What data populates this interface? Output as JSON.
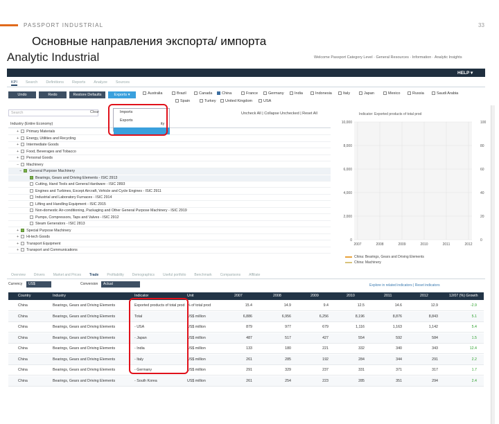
{
  "slide": {
    "company": "PASSPORT INDUSTRIAL",
    "page_number": "33",
    "title": "Основные направления экспорта/ импорта"
  },
  "app": {
    "brand": "Analytic Industrial",
    "welcome": "Welcome Passport Category Level  ·  General Resources  ·  Information  ·  Analytic Insights",
    "help": "HELP ▾",
    "tabs": [
      "KPI",
      "Search",
      "Definitions",
      "Reports",
      "Analyze",
      "Sources"
    ],
    "buttons": {
      "undo": "Undo",
      "redo": "Redo",
      "restore": "Restore Defaults",
      "exports": "Exports ▾"
    },
    "countries_row1": [
      "Australia",
      "Brazil",
      "Canada",
      "China",
      "France",
      "Germany",
      "India",
      "Indonesia",
      "Italy",
      "Japan",
      "Mexico",
      "Russia",
      "Saudi Arabia"
    ],
    "countries_row2": [
      "Spain",
      "Turkey",
      "United Kingdom",
      "USA"
    ],
    "search_placeholder": "Search",
    "clear": "Clear",
    "dropdown": {
      "imports": "Imports",
      "exports": "Exports",
      "tail": "ity"
    },
    "links": "Uncheck All  |  Collapse Unchecked  |  Reset All",
    "tree_header": "Industry (Entire Economy)",
    "tree": [
      {
        "pm": "+",
        "checked": false,
        "label": "Primary Materials",
        "hl": false
      },
      {
        "pm": "+",
        "checked": false,
        "label": "Energy, Utilities and Recycling",
        "hl": false
      },
      {
        "pm": "+",
        "checked": false,
        "label": "Intermediate Goods",
        "hl": false
      },
      {
        "pm": "+",
        "checked": false,
        "label": "Food, Beverages and Tobacco",
        "hl": false
      },
      {
        "pm": "+",
        "checked": false,
        "label": "Personal Goods",
        "hl": false
      },
      {
        "pm": "−",
        "checked": false,
        "label": "Machinery",
        "hl": false
      },
      {
        "pm": "−",
        "checked": true,
        "label": "General Purpose Machinery",
        "hl": true
      },
      {
        "pm": "",
        "checked": true,
        "label": "Bearings, Gears and Driving Elements - ISIC 2913",
        "hl": true
      },
      {
        "pm": "",
        "checked": false,
        "label": "Cutting, Hand Tools and General Hardware - ISIC 2893",
        "hl": false
      },
      {
        "pm": "",
        "checked": false,
        "label": "Engines and Turbines, Except Aircraft, Vehicle and Cycle Engines - ISIC 2911",
        "hl": false
      },
      {
        "pm": "",
        "checked": false,
        "label": "Industrial and Laboratory Furnaces - ISIC 2914",
        "hl": false
      },
      {
        "pm": "",
        "checked": false,
        "label": "Lifting and Handling Equipment - ISIC 2915",
        "hl": false
      },
      {
        "pm": "",
        "checked": false,
        "label": "Non-domestic Air-conditioning, Packaging and Other General Purpose Machinery - ISIC 2919",
        "hl": false
      },
      {
        "pm": "",
        "checked": false,
        "label": "Pumps, Compressors, Taps and Valves - ISIC 2912",
        "hl": false
      },
      {
        "pm": "",
        "checked": false,
        "label": "Steam Generators - ISIC 2813",
        "hl": false
      },
      {
        "pm": "+",
        "checked": true,
        "label": "Special Purpose Machinery",
        "hl": false
      },
      {
        "pm": "+",
        "checked": false,
        "label": "Hi-tech Goods",
        "hl": false
      },
      {
        "pm": "+",
        "checked": false,
        "label": "Transport Equipment",
        "hl": false
      },
      {
        "pm": "+",
        "checked": false,
        "label": "Transport and Communications",
        "hl": false
      }
    ],
    "bottom_tabs": [
      "Overview",
      "Drivers",
      "Market and Prices",
      "Trade",
      "Profitability",
      "Demographics",
      "Useful portfolio",
      "Benchmark",
      "Comparisons",
      "Affiliate"
    ],
    "currency_label": "Currency",
    "currency_value": "US$",
    "conversion_label": "Conversion",
    "conversion_value": "Actual",
    "explore": "Explore in related indicators  |  Reset indicators",
    "table": {
      "headers": [
        "Country",
        "Industry",
        "Indicator",
        "Unit",
        "2007",
        "2008",
        "2009",
        "2010",
        "2011",
        "2012",
        "12/07 (%) Growth"
      ],
      "rows": [
        [
          "China",
          "Bearings, Gears and Driving Elements",
          "Exported products of total prod",
          "% of total prod",
          "15.4",
          "14.9",
          "9.4",
          "12.5",
          "14.6",
          "12.9",
          "-2.9"
        ],
        [
          "China",
          "Bearings, Gears and Driving Elements",
          "Total",
          "US$ million",
          "6,886",
          "6,956",
          "6,256",
          "8,196",
          "8,876",
          "8,843",
          "5.1"
        ],
        [
          "China",
          "Bearings, Gears and Driving Elements",
          "- USA",
          "US$ million",
          "879",
          "977",
          "679",
          "1,116",
          "1,163",
          "1,142",
          "5.4"
        ],
        [
          "China",
          "Bearings, Gears and Driving Elements",
          "- Japan",
          "US$ million",
          "487",
          "517",
          "427",
          "554",
          "592",
          "584",
          "1.5"
        ],
        [
          "China",
          "Bearings, Gears and Driving Elements",
          "- India",
          "US$ million",
          "133",
          "180",
          "221",
          "332",
          "340",
          "343",
          "12.4"
        ],
        [
          "China",
          "Bearings, Gears and Driving Elements",
          "- Italy",
          "US$ million",
          "261",
          "285",
          "192",
          "284",
          "344",
          "291",
          "2.2"
        ],
        [
          "China",
          "Bearings, Gears and Driving Elements",
          "- Germany",
          "US$ million",
          "291",
          "329",
          "237",
          "331",
          "371",
          "317",
          "1.7"
        ],
        [
          "China",
          "Bearings, Gears and Driving Elements",
          "- South Korea",
          "US$ million",
          "261",
          "254",
          "223",
          "285",
          "351",
          "294",
          "2.4"
        ]
      ]
    },
    "chart_data": {
      "type": "line",
      "title": "Indicator: Exported products of total prod",
      "x": [
        "2007",
        "2008",
        "2009",
        "2010",
        "2011",
        "2012"
      ],
      "ylim": [
        0,
        10000
      ],
      "yticks_left": [
        "10,000",
        "8,000",
        "6,000",
        "4,000",
        "2,000",
        "0"
      ],
      "yticks_right": [
        "100",
        "80",
        "60",
        "40",
        "20",
        "0"
      ],
      "series": [
        {
          "name": "China: Bearings, Gears and Driving Elements",
          "values": [],
          "color": "#e8a23a"
        },
        {
          "name": "China: Machinery",
          "values": [],
          "color": "#d8c27a"
        }
      ]
    },
    "colors": {
      "accent_blue": "#3aa0dd",
      "dark_navy": "#223446",
      "red_highlight": "#e0101a",
      "growth_green": "#2ca02c"
    }
  }
}
